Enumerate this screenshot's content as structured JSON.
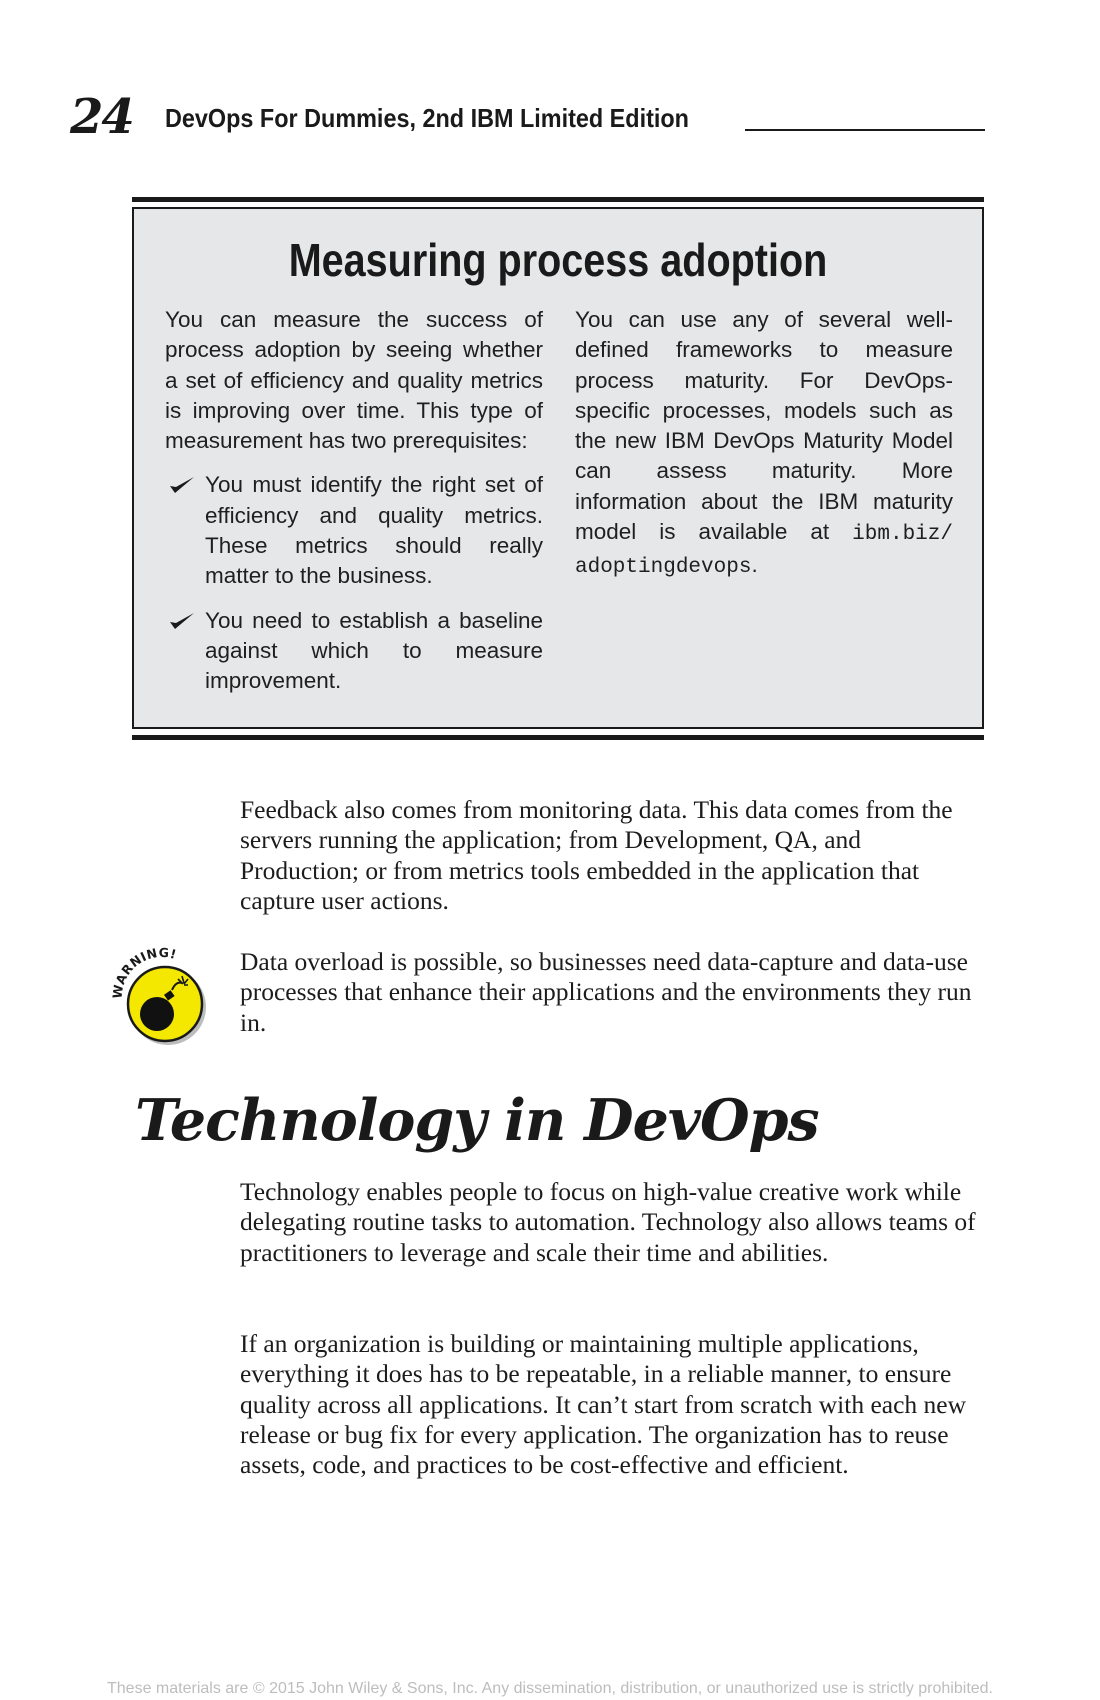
{
  "header": {
    "page_number": "24",
    "book_title": "DevOps For Dummies, 2nd IBM Limited Edition"
  },
  "sidebar": {
    "title": "Measuring process adoption",
    "left_intro": "You can measure the success of process adoption by seeing whether a set of efficiency and quality metrics is improving over time. This type of measurement has two prerequisites:",
    "bullets": [
      "You must identify the right set of efficiency and quality metrics. These metrics should really matter to the business.",
      "You need to establish a baseline against which to measure improvement."
    ],
    "right_text": "You can use any of several well-defined frameworks to measure process maturity. For DevOps-specific processes, models such as the new IBM DevOps Maturity Model can assess maturity. More information about the IBM maturity model is available at ",
    "right_link": "ibm.biz/ adoptingdevops",
    "right_end": "."
  },
  "body": {
    "p1": "Feedback also comes from monitoring data. This data comes from the servers running the application; from Development, QA, and Production; or from metrics tools embedded in the application that capture user actions.",
    "warning_label": "WARNING!",
    "p2": "Data overload is possible, so businesses need data-capture and data-use processes that enhance their applications and the environments they run in.",
    "section_heading": "Technology in DevOps",
    "p3": "Technology enables people to focus on high-value creative work while delegating routine tasks to automation. Technology also allows teams of practitioners to leverage and scale their time and abilities.",
    "p4": "If an organization is building or maintaining multiple applications, everything it does has to be repeatable, in a reliable manner, to ensure quality across all applications. It can’t start from scratch with each new release or bug fix for every application. The organization has to reuse assets, code, and practices to be cost-effective and efficient."
  },
  "footer": {
    "copyright": "These materials are © 2015 John Wiley & Sons, Inc. Any dissemination, distribution, or unauthorized use is strictly prohibited."
  }
}
